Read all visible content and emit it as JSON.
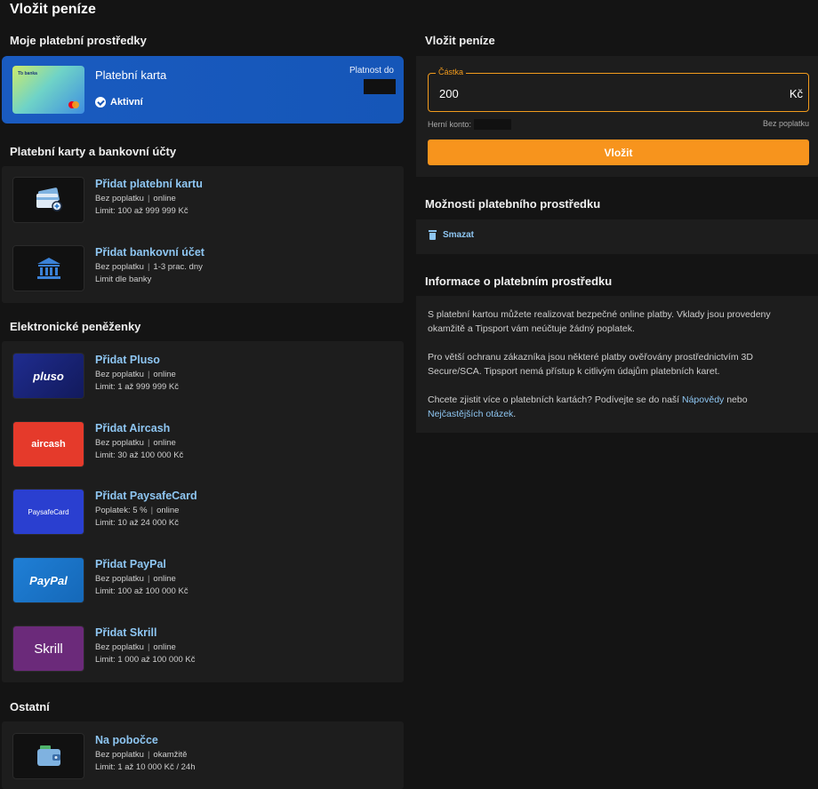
{
  "page": {
    "title": "Vložit peníze"
  },
  "my_methods": {
    "heading": "Moje platební prostředky",
    "card": {
      "name": "Platební karta",
      "bank_logo": "Tb banka",
      "status": "Aktivní",
      "expiry_label": "Platnost do"
    }
  },
  "cards_section": {
    "heading": "Platební karty a bankovní účty",
    "items": [
      {
        "title": "Přidat platební kartu",
        "fee": "Bez poplatku",
        "speed": "online",
        "limit": "Limit: 100 až 999 999 Kč",
        "icon": "credit-card-add-icon"
      },
      {
        "title": "Přidat bankovní účet",
        "fee": "Bez poplatku",
        "speed": "1-3 prac. dny",
        "limit": "Limit dle banky",
        "icon": "bank-icon"
      }
    ]
  },
  "ewallets_section": {
    "heading": "Elektronické peněženky",
    "items": [
      {
        "title": "Přidat Pluso",
        "fee": "Bez poplatku",
        "speed": "online",
        "limit": "Limit: 1 až 999 999 Kč",
        "brand": "pluso"
      },
      {
        "title": "Přidat Aircash",
        "fee": "Bez poplatku",
        "speed": "online",
        "limit": "Limit: 30 až 100 000 Kč",
        "brand": "aircash"
      },
      {
        "title": "Přidat PaysafeCard",
        "fee": "Poplatek: 5 %",
        "speed": "online",
        "limit": "Limit: 10 až 24 000 Kč",
        "brand": "PaysafeCard"
      },
      {
        "title": "Přidat PayPal",
        "fee": "Bez poplatku",
        "speed": "online",
        "limit": "Limit: 100 až 100 000 Kč",
        "brand": "PayPal"
      },
      {
        "title": "Přidat Skrill",
        "fee": "Bez poplatku",
        "speed": "online",
        "limit": "Limit: 1 000 až 100 000 Kč",
        "brand": "Skrill"
      }
    ]
  },
  "other_section": {
    "heading": "Ostatní",
    "items": [
      {
        "title": "Na pobočce",
        "fee": "Bez poplatku",
        "speed": "okamžitě",
        "limit": "Limit: 1 až 10 000 Kč / 24h",
        "icon": "wallet-icon"
      }
    ]
  },
  "deposit": {
    "heading": "Vložit peníze",
    "amount_label": "Částka",
    "amount_value": "200",
    "currency": "Kč",
    "account_label": "Herní konto:",
    "fee_note": "Bez poplatku",
    "submit_label": "Vložit"
  },
  "options": {
    "heading": "Možnosti platebního prostředku",
    "delete_label": "Smazat"
  },
  "info": {
    "heading": "Informace o platebním prostředku",
    "p1": "S platební kartou můžete realizovat bezpečné online platby. Vklady jsou provedeny okamžitě a Tipsport vám neúčtuje žádný poplatek.",
    "p2": "Pro větší ochranu zákazníka jsou některé platby ověřovány prostřednictvím 3D Secure/SCA. Tipsport nemá přístup k citlivým údajům platebních karet.",
    "p3_prefix": "Chcete zjistit více o platebních kartách? Podívejte se do naší ",
    "p3_link1": "Nápovědy",
    "p3_middle": " nebo ",
    "p3_link2": "Nejčastějších otázek",
    "p3_suffix": "."
  },
  "colors": {
    "accent": "#f7941d",
    "link": "#8ec6f2",
    "card_blue": "#1556b8",
    "panel": "#1d1d1d",
    "bg": "#141414"
  }
}
